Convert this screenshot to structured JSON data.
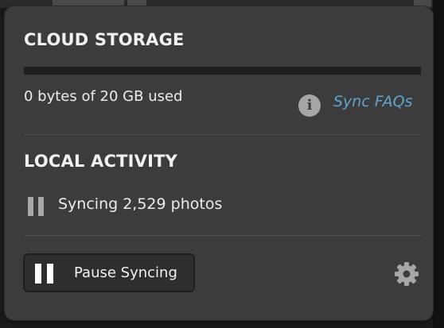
{
  "cloud_storage": {
    "title": "CLOUD STORAGE",
    "usage_text": "0 bytes of 20 GB used",
    "used_fraction": 0,
    "info_icon": "info-icon",
    "faq_link": "Sync FAQs"
  },
  "local_activity": {
    "title": "LOCAL ACTIVITY",
    "status_icon": "pause-icon",
    "status_text": "Syncing 2,529 photos"
  },
  "footer": {
    "pause_button_label": "Pause Syncing",
    "pause_button_icon": "pause-icon",
    "settings_icon": "gear-icon"
  },
  "colors": {
    "panel_background": "#3c3c3c",
    "link": "#5fa5d0",
    "storage_track": "#202020",
    "text": "#ececec"
  }
}
